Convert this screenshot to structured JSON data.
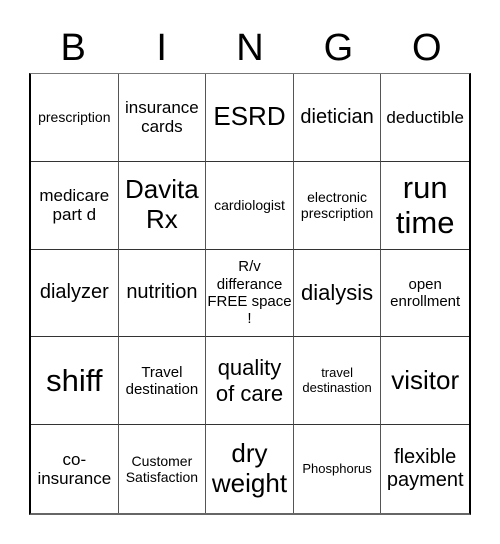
{
  "header": {
    "letters": [
      "B",
      "I",
      "N",
      "G",
      "O"
    ]
  },
  "card": {
    "rows": [
      [
        "prescription",
        "insurance cards",
        "ESRD",
        "dietician",
        "deductible"
      ],
      [
        "medicare part d",
        "Davita Rx",
        "cardiologist",
        "electronic prescription",
        "run time"
      ],
      [
        "dialyzer",
        "nutrition",
        "R/v differance FREE space !",
        "dialysis",
        "open enrollment"
      ],
      [
        "shiff",
        "Travel destination",
        "quality of care",
        "travel destinastion",
        "visitor"
      ],
      [
        "co-insurance",
        "Customer Satisfaction",
        "dry weight",
        "Phosphorus",
        "flexible payment"
      ]
    ],
    "free_space": "R/v differance FREE space !"
  }
}
